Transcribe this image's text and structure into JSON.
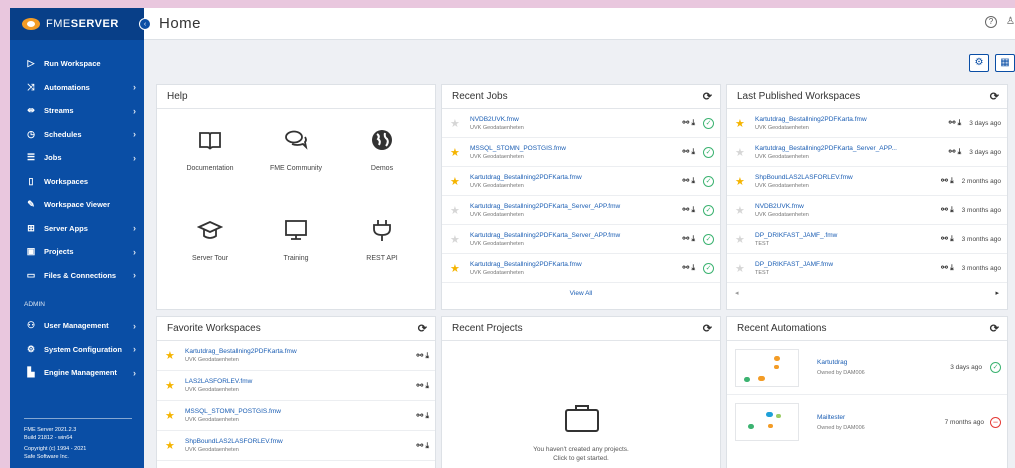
{
  "brand": {
    "name_light": "FME",
    "name_bold": "SERVER"
  },
  "header": {
    "title": "Home"
  },
  "sidebar": {
    "items": [
      {
        "label": "Run Workspace",
        "icon": "play-icon",
        "chevron": false
      },
      {
        "label": "Automations",
        "icon": "automation-icon",
        "chevron": true
      },
      {
        "label": "Streams",
        "icon": "stream-icon",
        "chevron": true
      },
      {
        "label": "Schedules",
        "icon": "clock-icon",
        "chevron": true
      },
      {
        "label": "Jobs",
        "icon": "list-icon",
        "chevron": true
      },
      {
        "label": "Workspaces",
        "icon": "file-icon",
        "chevron": false
      },
      {
        "label": "Workspace Viewer",
        "icon": "brush-icon",
        "chevron": false
      },
      {
        "label": "Server Apps",
        "icon": "apps-icon",
        "chevron": true
      },
      {
        "label": "Projects",
        "icon": "briefcase-icon",
        "chevron": true
      },
      {
        "label": "Files & Connections",
        "icon": "folder-icon",
        "chevron": true
      }
    ],
    "admin_label": "ADMIN",
    "admin_items": [
      {
        "label": "User Management",
        "icon": "users-icon",
        "chevron": true
      },
      {
        "label": "System Configuration",
        "icon": "gear-icon",
        "chevron": true
      },
      {
        "label": "Engine Management",
        "icon": "engine-icon",
        "chevron": true
      }
    ],
    "footer": [
      "FME Server 2021.2.3",
      "Build 21812 - win64",
      "Copyright (c) 1994 - 2021",
      "Safe Software Inc."
    ]
  },
  "help": {
    "title": "Help",
    "items": [
      {
        "label": "Documentation",
        "icon": "book-icon"
      },
      {
        "label": "FME Community",
        "icon": "chat-icon"
      },
      {
        "label": "Demos",
        "icon": "globe-icon"
      },
      {
        "label": "Server Tour",
        "icon": "graduation-cap-icon"
      },
      {
        "label": "Training",
        "icon": "monitor-icon"
      },
      {
        "label": "REST API",
        "icon": "plug-icon"
      }
    ]
  },
  "recent_jobs": {
    "title": "Recent Jobs",
    "view_all": "View All",
    "rows": [
      {
        "name": "NVDB2UVK.fmw",
        "repo": "UVK Geodataenheten",
        "fav": false
      },
      {
        "name": "MSSQL_STOMN_POSTGIS.fmw",
        "repo": "UVK Geodataenheten",
        "fav": true
      },
      {
        "name": "Kartutdrag_Bestallning2PDFKarta.fmw",
        "repo": "UVK Geodataenheten",
        "fav": true
      },
      {
        "name": "Kartutdrag_Bestallning2PDFKarta_Server_APP.fmw",
        "repo": "UVK Geodataenheten",
        "fav": false
      },
      {
        "name": "Kartutdrag_Bestallning2PDFKarta_Server_APP.fmw",
        "repo": "UVK Geodataenheten",
        "fav": false
      },
      {
        "name": "Kartutdrag_Bestallning2PDFKarta.fmw",
        "repo": "UVK Geodataenheten",
        "fav": true
      }
    ]
  },
  "published": {
    "title": "Last Published Workspaces",
    "rows": [
      {
        "name": "Kartutdrag_Bestallning2PDFKarta.fmw",
        "repo": "UVK Geodataenheten",
        "fav": true,
        "ago": "3 days ago"
      },
      {
        "name": "Kartutdrag_Bestallning2PDFKarta_Server_APP...",
        "repo": "UVK Geodataenheten",
        "fav": false,
        "ago": "3 days ago"
      },
      {
        "name": "ShpBoundLAS2LASFORLEV.fmw",
        "repo": "UVK Geodataenheten",
        "fav": true,
        "ago": "2 months ago"
      },
      {
        "name": "NVDB2UVK.fmw",
        "repo": "UVK Geodataenheten",
        "fav": false,
        "ago": "3 months ago"
      },
      {
        "name": "DP_DRIKFAST_JÄMF_.fmw",
        "repo": "TEST",
        "fav": false,
        "ago": "3 months ago"
      },
      {
        "name": "DP_DRIKFAST_JÄMF.fmw",
        "repo": "TEST",
        "fav": false,
        "ago": "3 months ago"
      }
    ]
  },
  "favorites": {
    "title": "Favorite Workspaces",
    "rows": [
      {
        "name": "Kartutdrag_Bestallning2PDFKarta.fmw",
        "repo": "UVK Geodataenheten"
      },
      {
        "name": "LAS2LASFORLEV.fmw",
        "repo": "UVK Geodataenheten"
      },
      {
        "name": "MSSQL_STOMN_POSTGIS.fmw",
        "repo": "UVK Geodataenheten"
      },
      {
        "name": "ShpBoundLAS2LASFORLEV.fmw",
        "repo": "UVK Geodataenheten"
      }
    ]
  },
  "projects": {
    "title": "Recent Projects",
    "empty_line1": "You haven't created any projects.",
    "empty_line2": "Click to get started."
  },
  "automations": {
    "title": "Recent Automations",
    "rows": [
      {
        "name": "Kartutdrag",
        "owner": "Owned by DAM006",
        "ago": "3 days ago",
        "status": "success"
      },
      {
        "name": "Mailtester",
        "owner": "Owned by DAM006",
        "ago": "7 months ago",
        "status": "error"
      }
    ]
  },
  "colors": {
    "brand_blue": "#0a4ea5",
    "star": "#f5b400",
    "success": "#3cb371",
    "error": "#e53935"
  }
}
